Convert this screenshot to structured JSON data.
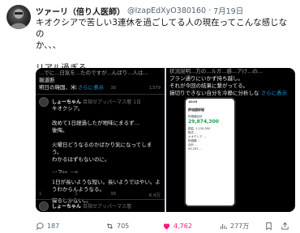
{
  "author": {
    "name": "ツァーリ（倍り人医師）",
    "handle": "@IzapEdXyO380160",
    "separator": "·",
    "date": "7月19日"
  },
  "post": {
    "line1": "キオクシアで苦しい3連休を過ごしてる人の現在ってこんな感じなの",
    "line2": "か、、、",
    "line3": "リアル過ぎる、、。"
  },
  "left_screen": {
    "top_lines": [
      "...でに...日気を...たのですが...んばり...人は...",
      "報道断",
      "明日の韓国、米"
    ],
    "more": "さらに表示",
    "stats": [
      "8",
      "1",
      "30",
      "1379"
    ],
    "reply": {
      "name": "しょーちゃん",
      "badge": "目指せアッパーマス層",
      "time": "1日",
      "lines": [
        "キオクシア。",
        "",
        "改めて1日経過したが地味にまるず…",
        "後悔。",
        "",
        "火曜日どうなるのかばかり気になってしまう。",
        "わかるはずもないのに。",
        "",
        "…っ。。…。",
        "",
        "1日が長いような短い。長いようではやい。ようわからんようなる。",
        "",
        "寝るしかない。。"
      ],
      "stats": [
        "1",
        "1",
        "36",
        "6.4万"
      ]
    },
    "reply2": {
      "name": "しょーちゃん",
      "badge": "目指せアッパーマス層"
    }
  },
  "right_screen": {
    "top_lines": [
      "状況説明...方の...ルガ...感...アけ...の...",
      "プラン通りにいかず持ち越し。",
      "それが今回の結果に繋がってる。",
      "損切りできない自分を冷静に分析しな"
    ],
    "more": "さらに表示",
    "phone": {
      "time": "18:05",
      "title": "評価額詳細",
      "total_label": "評価額合計",
      "total": "29,874,300",
      "rows": [
        "損益 -1,120,000",
        "株式 ...",
        "キオクシア ...",
        "評価額 ...",
        "合計 ..."
      ],
      "row_bottom": "94,187,..."
    }
  },
  "actions": {
    "replies": "187",
    "retweets": "705",
    "likes": "4,762",
    "views": "277万"
  },
  "colors": {
    "like": "#f91880",
    "link": "#1d9bf0",
    "muted": "#536471"
  }
}
